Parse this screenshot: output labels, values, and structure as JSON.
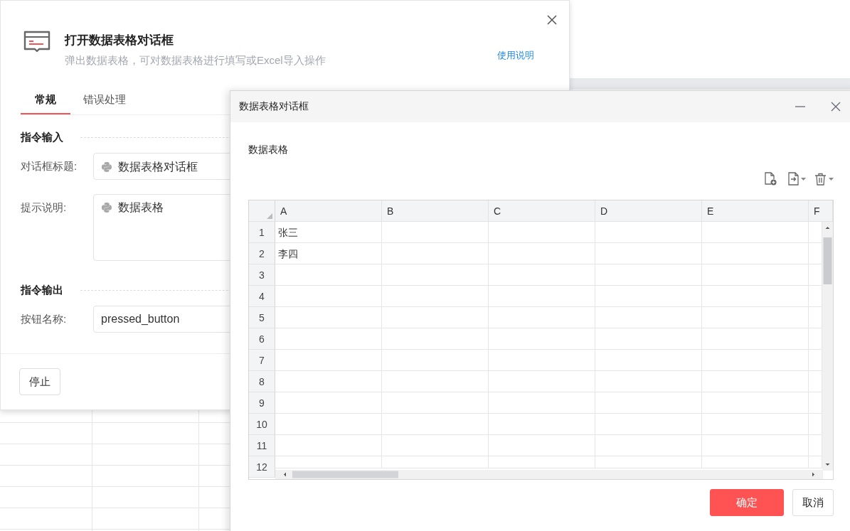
{
  "main_dialog": {
    "title": "打开数据表格对话框",
    "subtitle": "弹出数据表格，可对数据表格进行填写或Excel导入操作",
    "help_link": "使用说明",
    "tabs": [
      {
        "label": "常规",
        "selected": true
      },
      {
        "label": "错误处理",
        "selected": false
      }
    ],
    "sections": [
      {
        "title": "指令输入",
        "fields": [
          {
            "label": "对话框标题:",
            "kind": "python",
            "value": "数据表格对话框"
          },
          {
            "label": "提示说明:",
            "kind": "python-multiline",
            "value": "数据表格"
          }
        ]
      },
      {
        "title": "指令输出",
        "fields": [
          {
            "label": "按钮名称:",
            "kind": "text",
            "value": "pressed_button"
          }
        ]
      }
    ],
    "footer_button": "停止"
  },
  "table_dialog": {
    "title": "数据表格对话框",
    "table_title": "数据表格",
    "columns": [
      "A",
      "B",
      "C",
      "D",
      "E",
      "F"
    ],
    "rows": [
      {
        "number": "1",
        "cells": [
          "张三"
        ]
      },
      {
        "number": "2",
        "cells": [
          "李四"
        ]
      },
      {
        "number": "3",
        "cells": []
      },
      {
        "number": "4",
        "cells": []
      },
      {
        "number": "5",
        "cells": []
      },
      {
        "number": "6",
        "cells": []
      },
      {
        "number": "7",
        "cells": []
      },
      {
        "number": "8",
        "cells": []
      },
      {
        "number": "9",
        "cells": []
      },
      {
        "number": "10",
        "cells": []
      },
      {
        "number": "11",
        "cells": []
      },
      {
        "number": "12",
        "cells": []
      }
    ],
    "buttons": [
      {
        "label": "确定",
        "kind": "primary"
      },
      {
        "label": "取消",
        "kind": "secondary"
      }
    ]
  }
}
